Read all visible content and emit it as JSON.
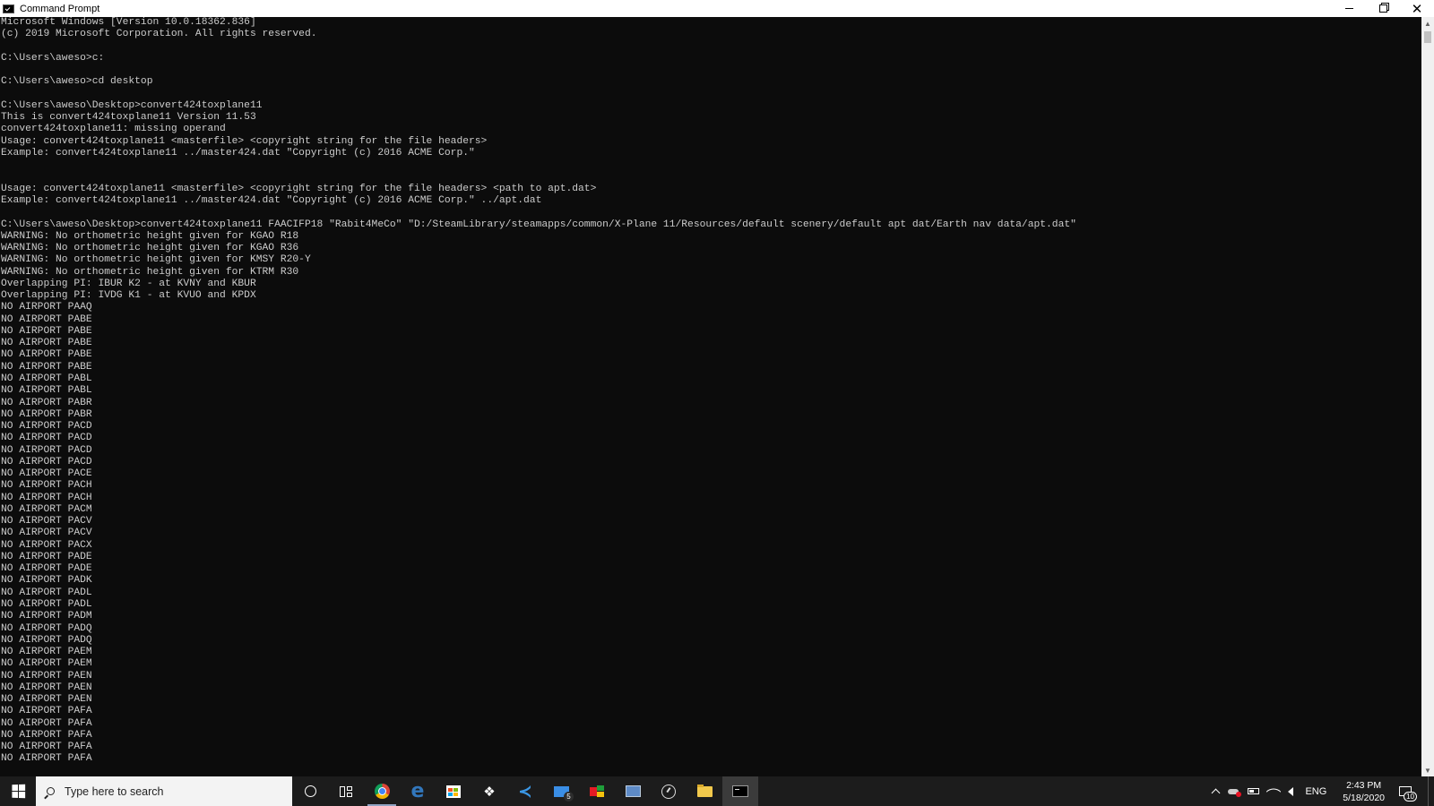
{
  "window": {
    "title": "Command Prompt",
    "controls": {
      "minimize": "",
      "maximize": "",
      "close": "✕"
    }
  },
  "console": {
    "lines": [
      "Microsoft Windows [Version 10.0.18362.836]",
      "(c) 2019 Microsoft Corporation. All rights reserved.",
      "",
      "C:\\Users\\aweso>c:",
      "",
      "C:\\Users\\aweso>cd desktop",
      "",
      "C:\\Users\\aweso\\Desktop>convert424toxplane11",
      "This is convert424toxplane11 Version 11.53",
      "convert424toxplane11: missing operand",
      "Usage: convert424toxplane11 <masterfile> <copyright string for the file headers>",
      "Example: convert424toxplane11 ../master424.dat \"Copyright (c) 2016 ACME Corp.\"",
      "",
      "",
      "Usage: convert424toxplane11 <masterfile> <copyright string for the file headers> <path to apt.dat>",
      "Example: convert424toxplane11 ../master424.dat \"Copyright (c) 2016 ACME Corp.\" ../apt.dat",
      "",
      "C:\\Users\\aweso\\Desktop>convert424toxplane11 FAACIFP18 \"Rabit4MeCo\" \"D:/SteamLibrary/steamapps/common/X-Plane 11/Resources/default scenery/default apt dat/Earth nav data/apt.dat\"",
      "WARNING: No orthometric height given for KGAO R18",
      "WARNING: No orthometric height given for KGAO R36",
      "WARNING: No orthometric height given for KMSY R20-Y",
      "WARNING: No orthometric height given for KTRM R30",
      "Overlapping PI: IBUR K2 - at KVNY and KBUR",
      "Overlapping PI: IVDG K1 - at KVUO and KPDX",
      "NO AIRPORT PAAQ",
      "NO AIRPORT PABE",
      "NO AIRPORT PABE",
      "NO AIRPORT PABE",
      "NO AIRPORT PABE",
      "NO AIRPORT PABE",
      "NO AIRPORT PABL",
      "NO AIRPORT PABL",
      "NO AIRPORT PABR",
      "NO AIRPORT PABR",
      "NO AIRPORT PACD",
      "NO AIRPORT PACD",
      "NO AIRPORT PACD",
      "NO AIRPORT PACD",
      "NO AIRPORT PACE",
      "NO AIRPORT PACH",
      "NO AIRPORT PACH",
      "NO AIRPORT PACM",
      "NO AIRPORT PACV",
      "NO AIRPORT PACV",
      "NO AIRPORT PACX",
      "NO AIRPORT PADE",
      "NO AIRPORT PADE",
      "NO AIRPORT PADK",
      "NO AIRPORT PADL",
      "NO AIRPORT PADL",
      "NO AIRPORT PADM",
      "NO AIRPORT PADQ",
      "NO AIRPORT PADQ",
      "NO AIRPORT PAEM",
      "NO AIRPORT PAEM",
      "NO AIRPORT PAEN",
      "NO AIRPORT PAEN",
      "NO AIRPORT PAEN",
      "NO AIRPORT PAFA",
      "NO AIRPORT PAFA",
      "NO AIRPORT PAFA",
      "NO AIRPORT PAFA",
      "NO AIRPORT PAFA"
    ]
  },
  "scrollbar": {
    "up_arrow": "▲",
    "down_arrow": "▼"
  },
  "taskbar": {
    "search_placeholder": "Type here to search",
    "apps": [
      {
        "name": "cortana-icon"
      },
      {
        "name": "task-view-icon"
      },
      {
        "name": "chrome-icon"
      },
      {
        "name": "edge-icon"
      },
      {
        "name": "store-icon"
      },
      {
        "name": "dropbox-icon"
      },
      {
        "name": "vscode-icon"
      },
      {
        "name": "mail-icon"
      },
      {
        "name": "xplane-icon"
      },
      {
        "name": "remote-desktop-icon"
      },
      {
        "name": "gauge-icon"
      },
      {
        "name": "file-explorer-icon"
      },
      {
        "name": "command-prompt-icon"
      }
    ],
    "mail_badge": "5",
    "language": "ENG",
    "time": "2:43 PM",
    "date": "5/18/2020",
    "notification_count": "10"
  },
  "colors": {
    "console_bg": "#0c0c0c",
    "console_text": "#cccccc",
    "taskbar_bg": "#1c1c1c",
    "titlebar_bg": "#ffffff"
  }
}
